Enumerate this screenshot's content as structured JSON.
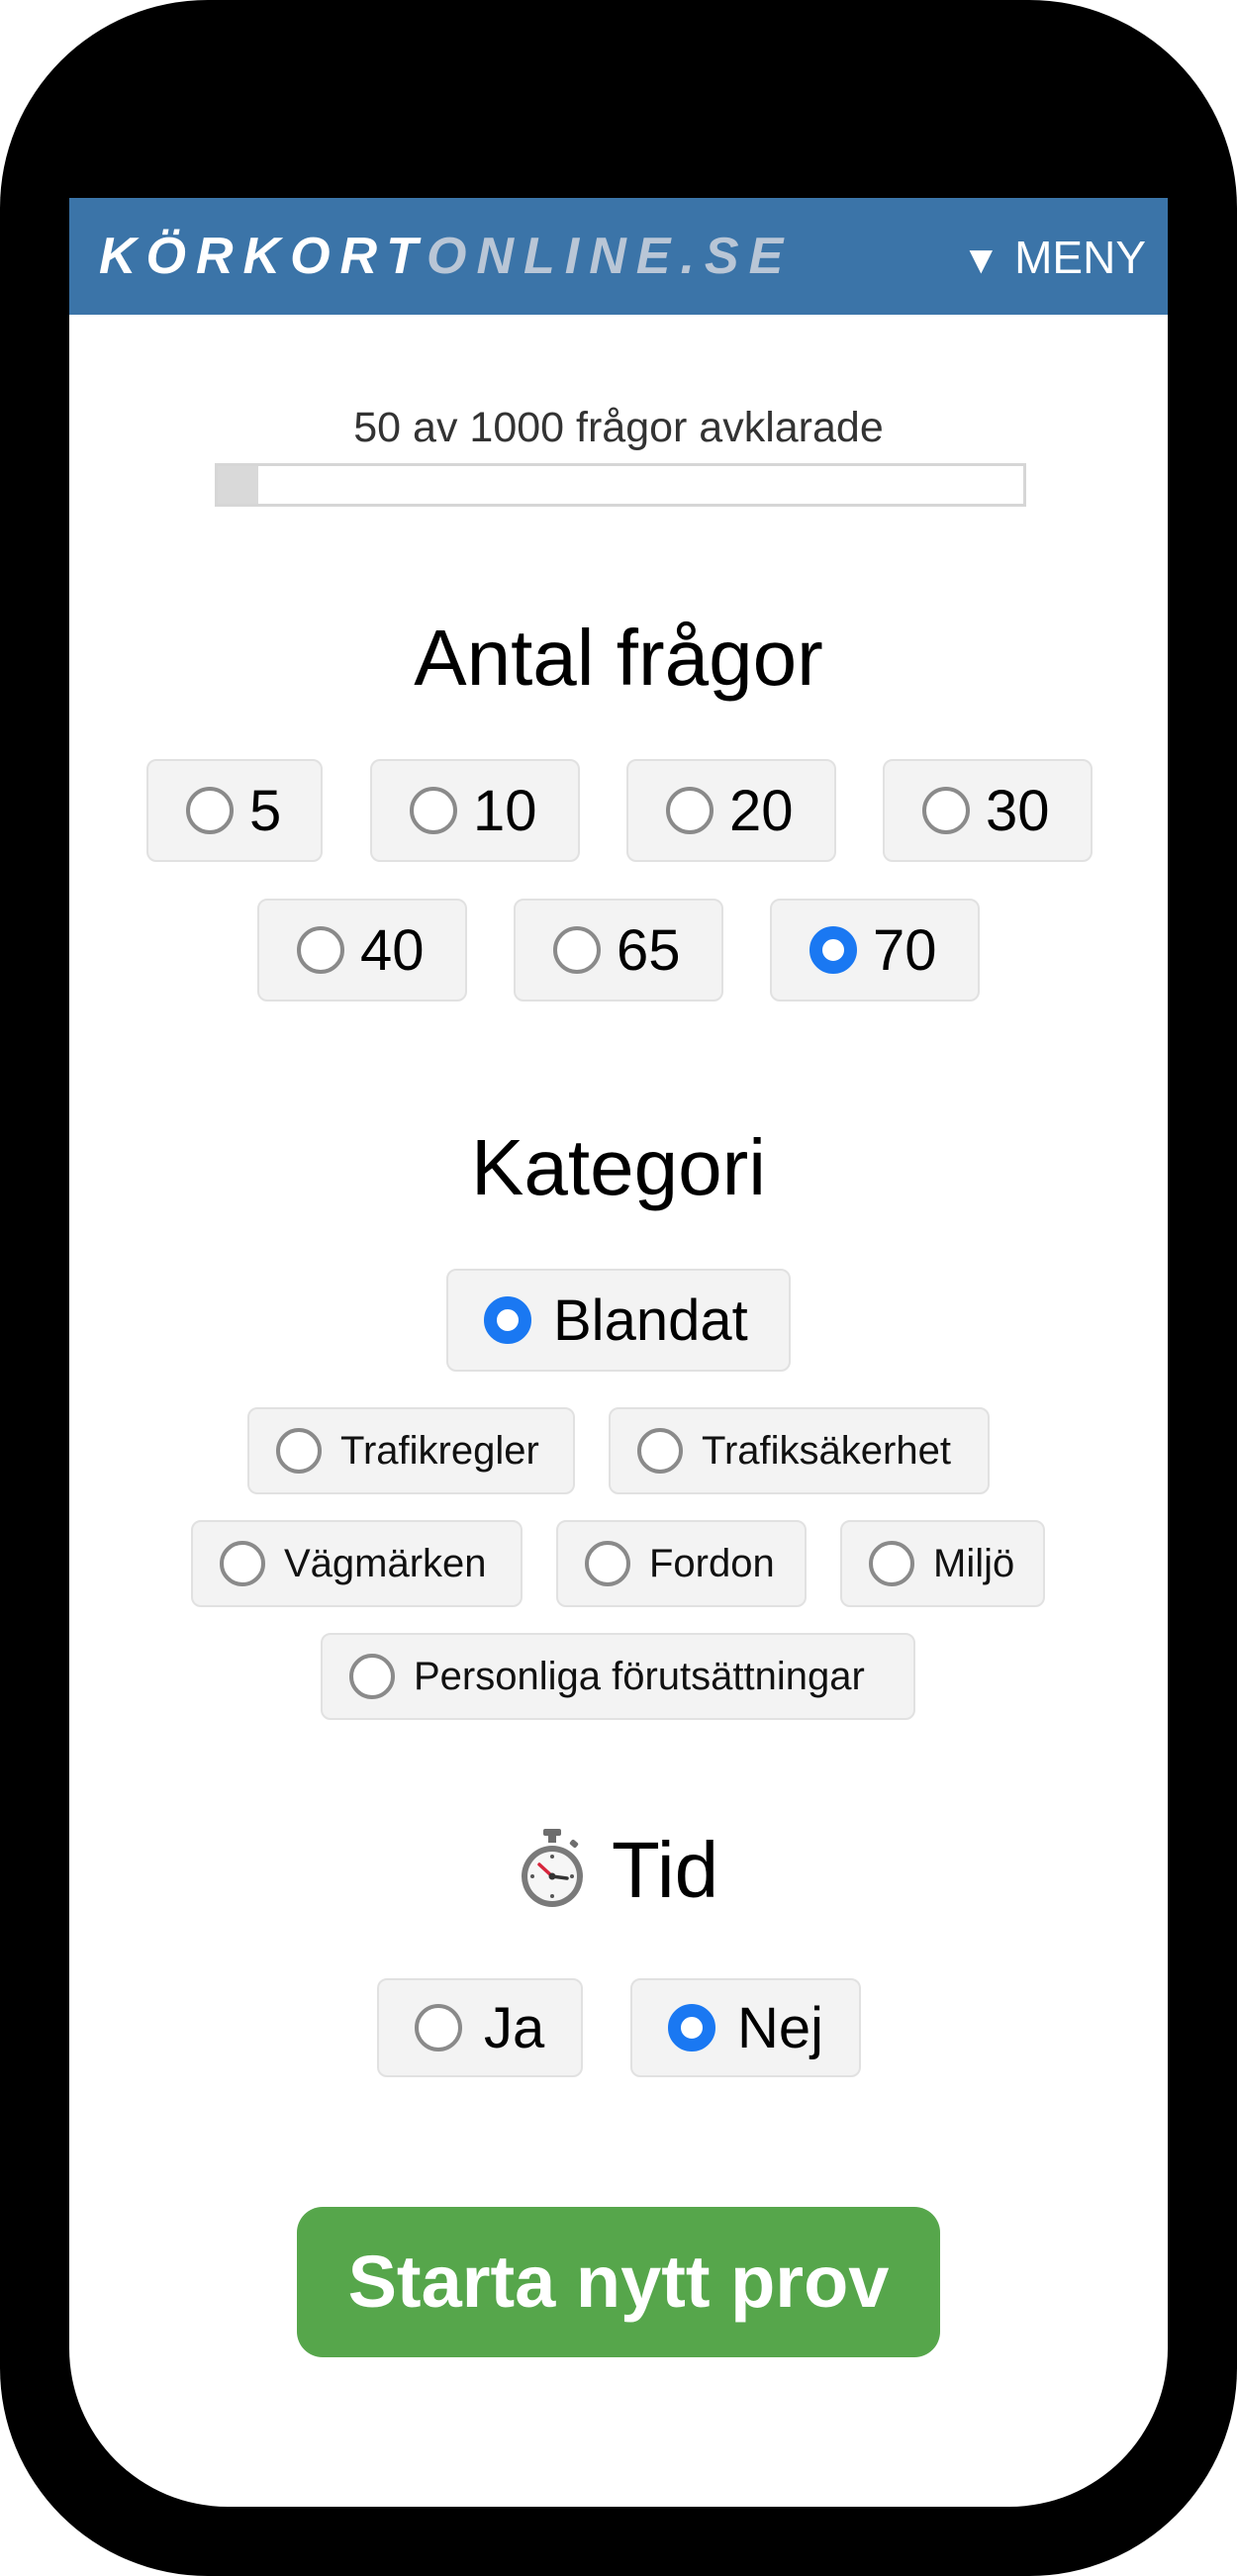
{
  "header": {
    "logo_part1": "KÖRKORT",
    "logo_part2": "ONLINE.SE",
    "menu_arrow": "▼",
    "menu_label": "MENY"
  },
  "progress": {
    "text": "50 av 1000 frågor avklarade",
    "completed": 50,
    "total": 1000
  },
  "question_count": {
    "title": "Antal frågor",
    "options": [
      {
        "label": "5",
        "selected": false
      },
      {
        "label": "10",
        "selected": false
      },
      {
        "label": "20",
        "selected": false
      },
      {
        "label": "30",
        "selected": false
      },
      {
        "label": "40",
        "selected": false
      },
      {
        "label": "65",
        "selected": false
      },
      {
        "label": "70",
        "selected": true
      }
    ]
  },
  "category": {
    "title": "Kategori",
    "options": [
      {
        "label": "Blandat",
        "selected": true
      },
      {
        "label": "Trafikregler",
        "selected": false
      },
      {
        "label": "Trafiksäkerhet",
        "selected": false
      },
      {
        "label": "Vägmärken",
        "selected": false
      },
      {
        "label": "Fordon",
        "selected": false
      },
      {
        "label": "Miljö",
        "selected": false
      },
      {
        "label": "Personliga förutsättningar",
        "selected": false
      }
    ]
  },
  "time": {
    "title": "Tid",
    "icon": "stopwatch-icon",
    "options": [
      {
        "label": "Ja",
        "selected": false
      },
      {
        "label": "Nej",
        "selected": true
      }
    ]
  },
  "start_button": {
    "label": "Starta nytt prov"
  },
  "colors": {
    "header_bg": "#3b74a8",
    "radio_selected": "#1a78f2",
    "start_button": "#56a64b"
  }
}
